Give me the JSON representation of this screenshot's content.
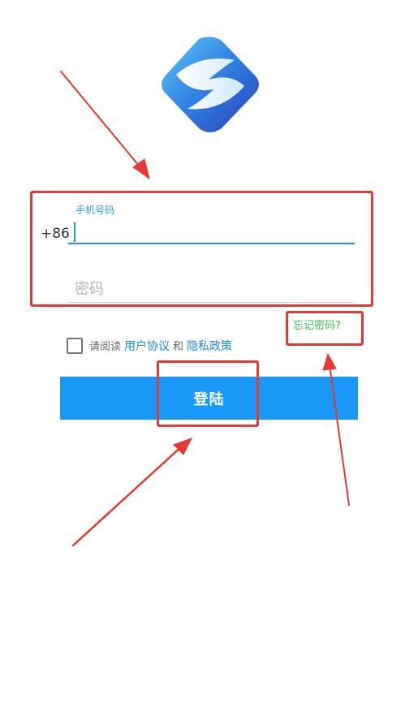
{
  "login_form": {
    "phone_label": "手机号码",
    "country_code": "+86",
    "phone_value": "",
    "password_placeholder": "密码",
    "forgot_password": "忘记密码?",
    "agreement": {
      "prefix": "请阅读",
      "user_agreement": "用户协议",
      "conjunction": "和",
      "privacy_policy": "隐私政策",
      "checked": false
    },
    "login_label": "登陆"
  },
  "icons": {
    "logo": "app-logo-icon",
    "checkbox": "checkbox-icon"
  },
  "colors": {
    "accent": "#1a98f7",
    "link": "#1e88e5",
    "forgot": "#3dbb4d",
    "annotation": "#e53935"
  }
}
